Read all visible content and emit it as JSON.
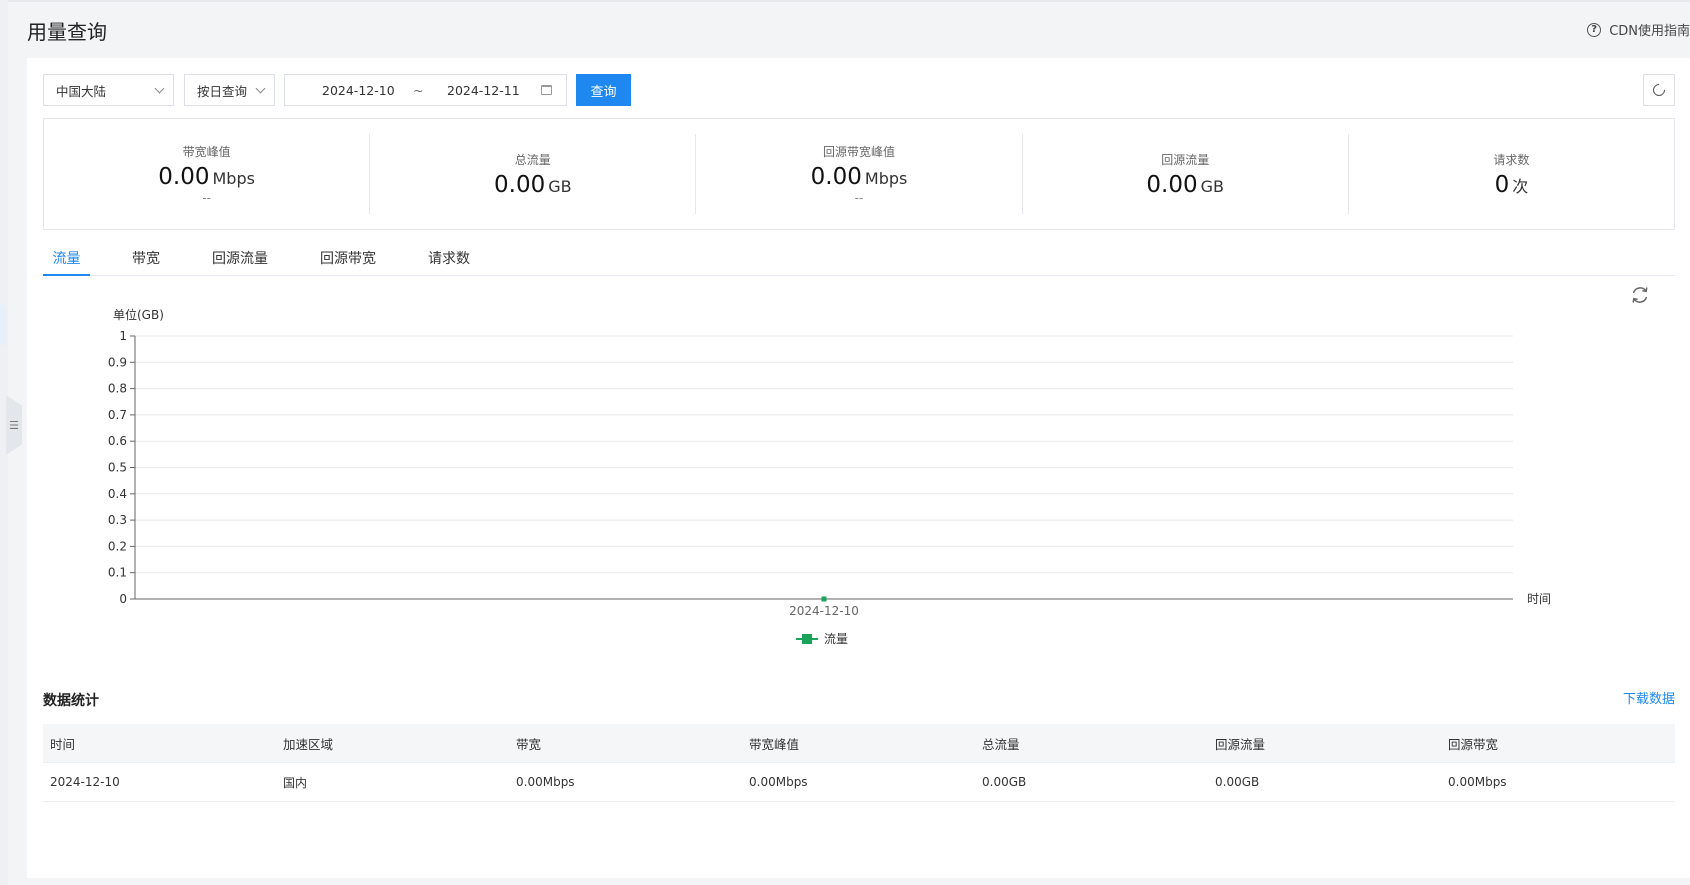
{
  "page": {
    "title": "用量查询",
    "guide_label": "CDN使用指南"
  },
  "filters": {
    "region": "中国大陆",
    "mode": "按日查询",
    "start_date": "2024-12-10",
    "separator": "~",
    "end_date": "2024-12-11",
    "query_label": "查询"
  },
  "stats": [
    {
      "label": "带宽峰值",
      "value": "0.00",
      "unit": "Mbps",
      "sub": "--"
    },
    {
      "label": "总流量",
      "value": "0.00",
      "unit": "GB",
      "sub": ""
    },
    {
      "label": "回源带宽峰值",
      "value": "0.00",
      "unit": "Mbps",
      "sub": "--"
    },
    {
      "label": "回源流量",
      "value": "0.00",
      "unit": "GB",
      "sub": ""
    },
    {
      "label": "请求数",
      "value": "0",
      "unit": "次",
      "sub": ""
    }
  ],
  "tabs": [
    "流量",
    "带宽",
    "回源流量",
    "回源带宽",
    "请求数"
  ],
  "active_tab": 0,
  "chart_data": {
    "type": "line",
    "ylabel": "单位(GB)",
    "xlabel": "时间",
    "ylim": [
      0,
      1
    ],
    "yticks": [
      "0",
      "0.1",
      "0.2",
      "0.3",
      "0.4",
      "0.5",
      "0.6",
      "0.7",
      "0.8",
      "0.9",
      "1"
    ],
    "x": [
      "2024-12-10"
    ],
    "series": [
      {
        "name": "流量",
        "values": [
          0
        ],
        "color": "#1aa35a"
      }
    ],
    "legend": "bottom-center",
    "grid": true
  },
  "table": {
    "title": "数据统计",
    "download_label": "下载数据",
    "columns": [
      "时间",
      "加速区域",
      "带宽",
      "带宽峰值",
      "总流量",
      "回源流量",
      "回源带宽"
    ],
    "rows": [
      [
        "2024-12-10",
        "国内",
        "0.00Mbps",
        "0.00Mbps",
        "0.00GB",
        "0.00GB",
        "0.00Mbps"
      ]
    ]
  },
  "colors": {
    "accent": "#1e88f0",
    "series": "#1aa35a"
  }
}
